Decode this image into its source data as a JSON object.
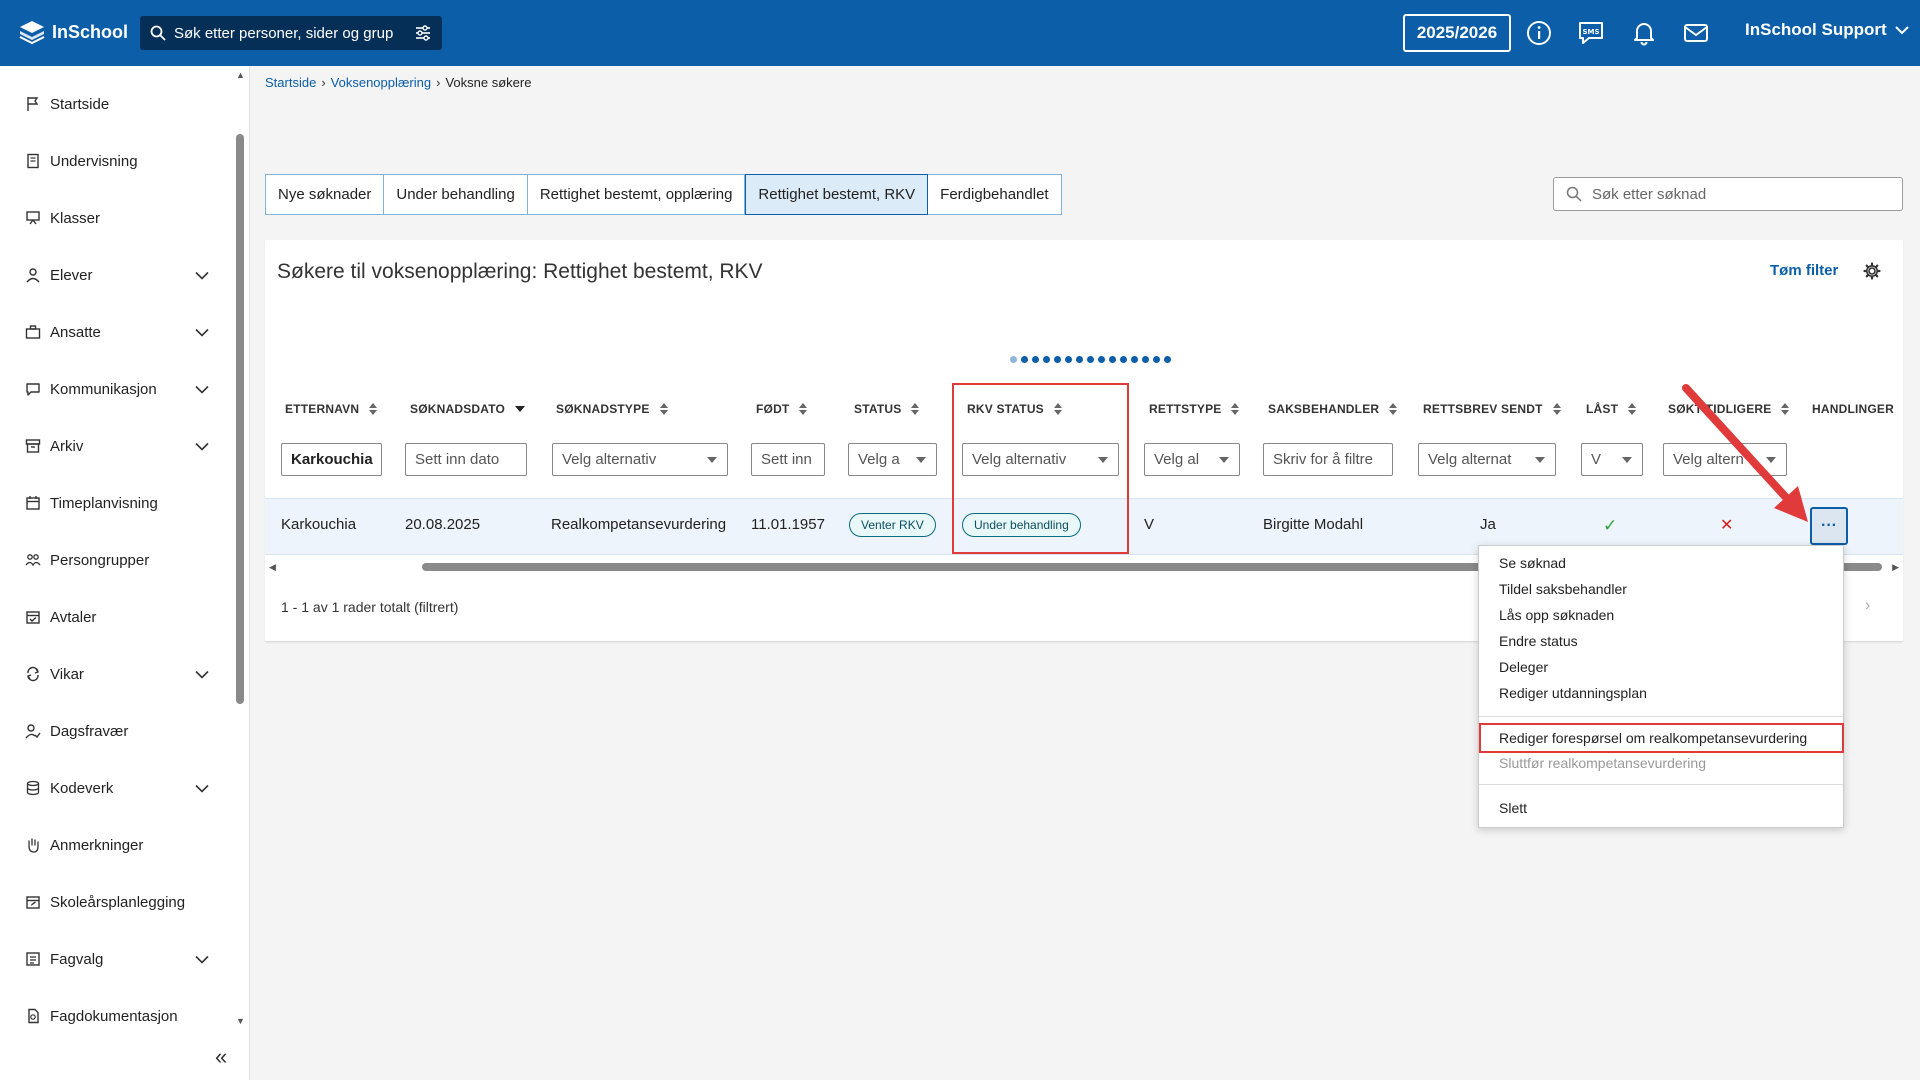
{
  "app": {
    "name": "InSchool"
  },
  "header": {
    "search_placeholder": "Søk etter personer, sider og grupper",
    "year": "2025/2026",
    "user": "InSchool Support"
  },
  "sidebar": {
    "items": [
      {
        "label": "Startside",
        "icon": "flag-icon",
        "expandable": false
      },
      {
        "label": "Undervisning",
        "icon": "book-icon",
        "expandable": false
      },
      {
        "label": "Klasser",
        "icon": "board-icon",
        "expandable": false
      },
      {
        "label": "Elever",
        "icon": "student-icon",
        "expandable": true
      },
      {
        "label": "Ansatte",
        "icon": "briefcase-icon",
        "expandable": true
      },
      {
        "label": "Kommunikasjon",
        "icon": "chat-icon",
        "expandable": true
      },
      {
        "label": "Arkiv",
        "icon": "archive-icon",
        "expandable": true
      },
      {
        "label": "Timeplanvisning",
        "icon": "calendar-icon",
        "expandable": false
      },
      {
        "label": "Persongrupper",
        "icon": "group-icon",
        "expandable": false
      },
      {
        "label": "Avtaler",
        "icon": "calendar-check-icon",
        "expandable": false
      },
      {
        "label": "Vikar",
        "icon": "swap-icon",
        "expandable": true
      },
      {
        "label": "Dagsfravær",
        "icon": "person-check-icon",
        "expandable": false
      },
      {
        "label": "Kodeverk",
        "icon": "database-icon",
        "expandable": true
      },
      {
        "label": "Anmerkninger",
        "icon": "hand-icon",
        "expandable": false
      },
      {
        "label": "Skoleårsplanlegging",
        "icon": "calendar-edit-icon",
        "expandable": false
      },
      {
        "label": "Fagvalg",
        "icon": "list-icon",
        "expandable": true
      },
      {
        "label": "Fagdokumentasjon",
        "icon": "document-icon",
        "expandable": false
      }
    ]
  },
  "breadcrumb": {
    "home": "Startside",
    "parent": "Voksenopplæring",
    "current": "Voksne søkere"
  },
  "tabs": [
    {
      "label": "Nye søknader"
    },
    {
      "label": "Under behandling"
    },
    {
      "label": "Rettighet bestemt, opplæring"
    },
    {
      "label": "Rettighet bestemt, RKV"
    },
    {
      "label": "Ferdigbehandlet"
    }
  ],
  "application_search_placeholder": "Søk etter søknad",
  "panel": {
    "title": "Søkere til voksenopplæring: Rettighet bestemt, RKV",
    "clear_filter": "Tøm filter"
  },
  "columns": {
    "etternavn": "ETTERNAVN",
    "soknadsdato": "SØKNADSDATO",
    "soknadstype": "SØKNADSTYPE",
    "fodt": "FØDT",
    "status": "STATUS",
    "rkv_status": "RKV STATUS",
    "rettstype": "RETTSTYPE",
    "saksbehandler": "SAKSBEHANDLER",
    "rettsbrev_sendt": "RETTSBREV SENDT",
    "last": "LÅST",
    "sokt_tidligere": "SØKT TIDLIGERE",
    "handlinger": "HANDLINGER"
  },
  "filters": {
    "etternavn": "Karkouchia",
    "soknadsdato": "Sett inn dato",
    "soknadstype": "Velg alternativ",
    "fodt": "Sett inn",
    "status": "Velg a",
    "rkv_status": "Velg alternativ",
    "rettstype": "Velg al",
    "saksbehandler": "Skriv for å filtre",
    "rettsbrev_sendt": "Velg alternat",
    "last": "V",
    "sokt_tidligere": "Velg altern"
  },
  "row": {
    "etternavn": "Karkouchia",
    "soknadsdato": "20.08.2025",
    "soknadstype": "Realkompetansevurdering",
    "fodt": "11.01.1957",
    "status": "Venter RKV",
    "rkv_status": "Under behandling",
    "rettstype": "V",
    "saksbehandler": "Birgitte Modahl",
    "rettsbrev_sendt": "Ja",
    "last": "✓",
    "sokt_tidligere": "✕",
    "actions": "···"
  },
  "footer": {
    "rows_text": "1 - 1 av 1 rader totalt (filtrert)"
  },
  "menu": {
    "items": [
      "Se søknad",
      "Tildel saksbehandler",
      "Lås opp søknaden",
      "Endre status",
      "Deleger",
      "Rediger utdanningsplan"
    ],
    "highlighted": "Rediger forespørsel om realkompetansevurdering",
    "disabled": "Sluttfør realkompetansevurdering",
    "delete": "Slett"
  },
  "colors": {
    "brand": "#0b5ea7",
    "highlight": "#e03a3a"
  }
}
